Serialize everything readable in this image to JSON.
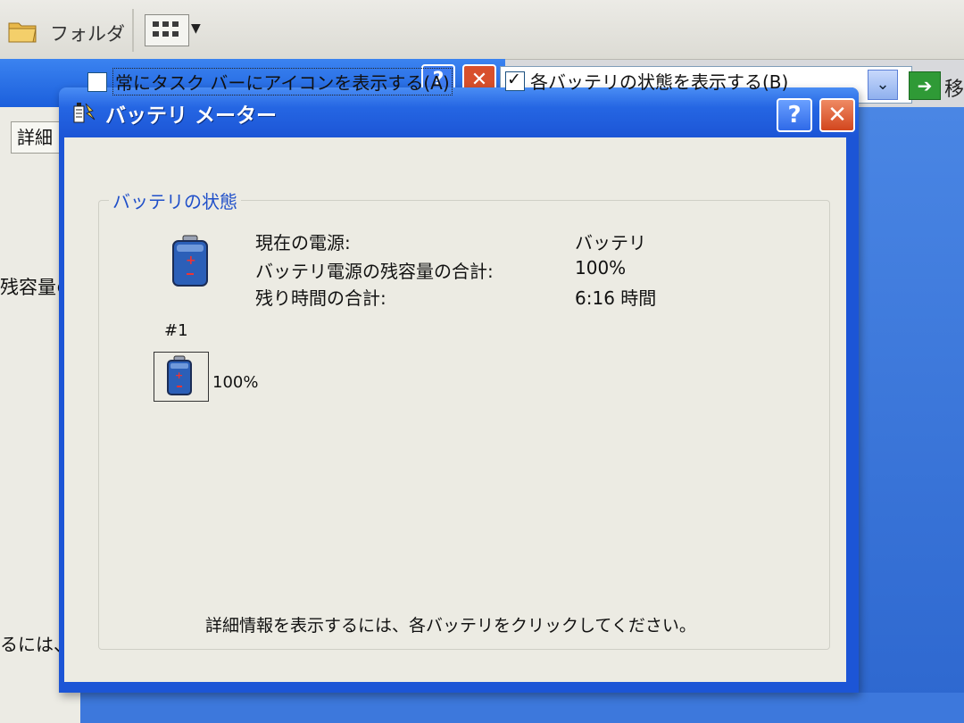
{
  "background": {
    "toolbar": {
      "folder_label": "フォルダ",
      "go_label": "移"
    },
    "partial_tab": "詳細",
    "partial_text_1": "残容量の",
    "partial_text_2": "るには、各"
  },
  "dialog": {
    "title": "バッテリ メーター",
    "help_label": "?",
    "close_label": "✕",
    "options": {
      "always_show_icon": {
        "label": "常にタスク バーにアイコンを表示する(A)",
        "checked": false
      },
      "show_each_battery": {
        "label": "各バッテリの状態を表示する(B)",
        "checked": true
      }
    },
    "status_group": {
      "title": "バッテリの状態",
      "rows": [
        {
          "label": "現在の電源:",
          "value": "バッテリ"
        },
        {
          "label": "バッテリ電源の残容量の合計:",
          "value": "100%"
        },
        {
          "label": "残り時間の合計:",
          "value": "6:16 時間"
        }
      ],
      "cells": [
        {
          "number": "#1",
          "percent": "100%"
        }
      ]
    },
    "hint": "詳細情報を表示するには、各バッテリをクリックしてください。"
  },
  "colors": {
    "title_blue": "#1c55d6",
    "group_title": "#1f4fc9",
    "dialog_bg": "#ecebe3"
  },
  "icons": [
    "folder-icon",
    "views-icon",
    "go-arrow-icon",
    "battery-meter-icon",
    "battery-icon",
    "help-icon",
    "close-icon"
  ]
}
